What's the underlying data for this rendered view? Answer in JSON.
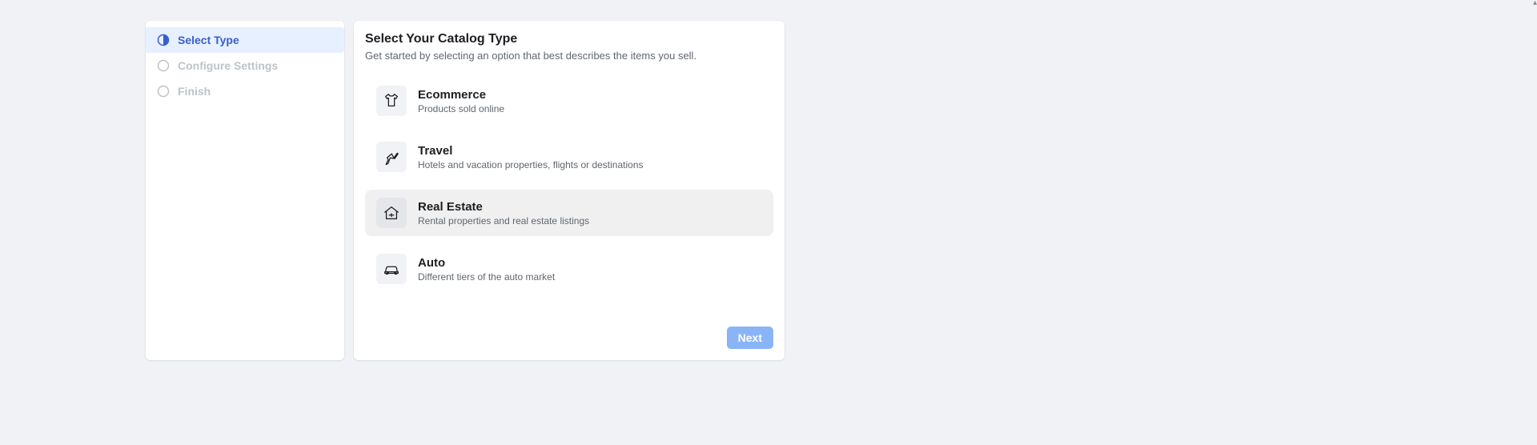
{
  "sidebar": {
    "steps": [
      {
        "label": "Select Type",
        "state": "active"
      },
      {
        "label": "Configure Settings",
        "state": "pending"
      },
      {
        "label": "Finish",
        "state": "pending"
      }
    ]
  },
  "main": {
    "heading": "Select Your Catalog Type",
    "subheading": "Get started by selecting an option that best describes the items you sell.",
    "options": [
      {
        "title": "Ecommerce",
        "desc": "Products sold online",
        "selected": false
      },
      {
        "title": "Travel",
        "desc": "Hotels and vacation properties, flights or destinations",
        "selected": false
      },
      {
        "title": "Real Estate",
        "desc": "Rental properties and real estate listings",
        "selected": true
      },
      {
        "title": "Auto",
        "desc": "Different tiers of the auto market",
        "selected": false
      }
    ],
    "next_label": "Next"
  }
}
